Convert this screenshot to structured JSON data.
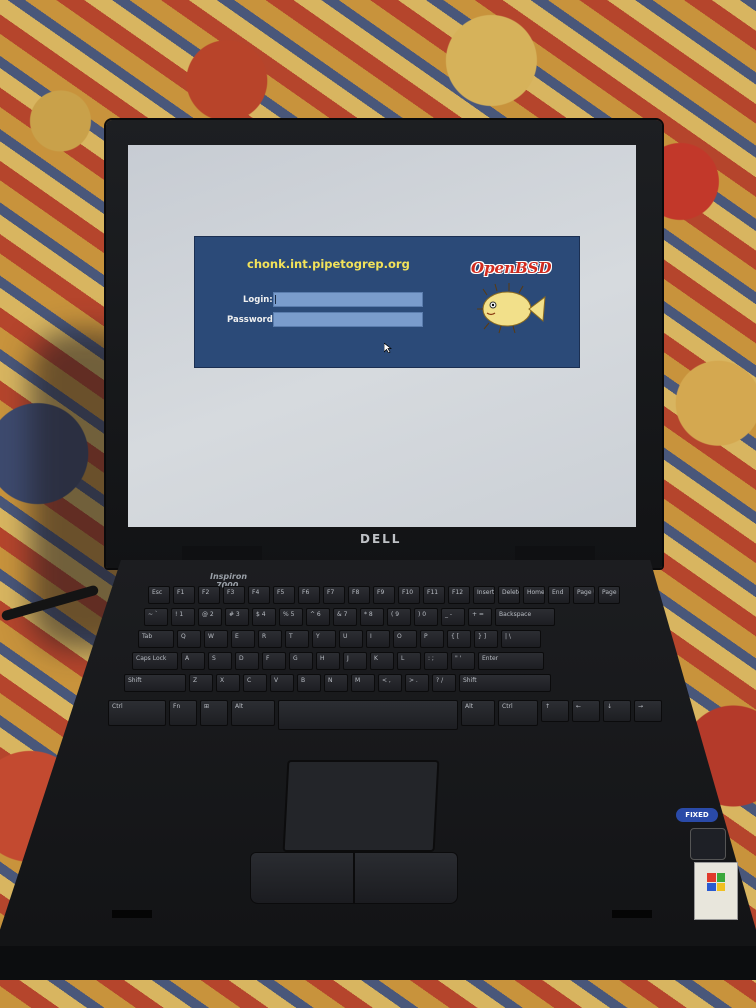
{
  "screen": {
    "hostname": "chonk.int.pipetogrep.org",
    "login_label": "Login:",
    "password_label": "Password:",
    "login_value": "",
    "password_value": "",
    "logo_text": "OpenBSD"
  },
  "laptop": {
    "brand": "DELL",
    "model_line1": "Inspiron",
    "model_line2": "7000",
    "badge_fixed": "FIXED"
  },
  "keyboard": {
    "rows": [
      [
        "Esc",
        "F1",
        "F2",
        "F3",
        "F4",
        "F5",
        "F6",
        "F7",
        "F8",
        "F9",
        "F10",
        "F11",
        "F12",
        "Insert",
        "Delete",
        "Home",
        "End",
        "Page Up",
        "Page Dn"
      ],
      [
        "~ `",
        "! 1",
        "@ 2",
        "# 3",
        "$ 4",
        "% 5",
        "^ 6",
        "& 7",
        "* 8",
        "( 9",
        ") 0",
        "_ -",
        "+ =",
        "Backspace"
      ],
      [
        "Tab",
        "Q",
        "W",
        "E",
        "R",
        "T",
        "Y",
        "U",
        "I",
        "O",
        "P",
        "{ [",
        "} ]",
        "| \\"
      ],
      [
        "Caps Lock",
        "A",
        "S",
        "D",
        "F",
        "G",
        "H",
        "J",
        "K",
        "L",
        ": ;",
        "\" '",
        "Enter"
      ],
      [
        "Shift",
        "Z",
        "X",
        "C",
        "V",
        "B",
        "N",
        "M",
        "< ,",
        "> .",
        "? /",
        "Shift"
      ],
      [
        "Ctrl",
        "Fn",
        "⊞",
        "Alt",
        "",
        "Alt",
        "Ctrl",
        "↑",
        "←",
        "↓",
        "→"
      ]
    ]
  },
  "colors": {
    "login_box": "#2b4a78",
    "hostname": "#f2e25a",
    "logo_red": "#d02a1e",
    "screen_bg": "#d3d7dc"
  }
}
